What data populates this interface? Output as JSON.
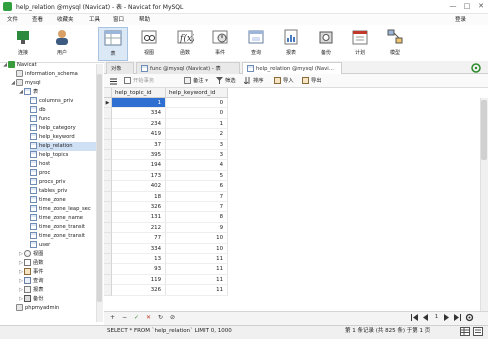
{
  "window": {
    "title": "help_relation @mysql (Navicat) - 表 - Navicat for MySQL",
    "controls": [
      "—",
      "□",
      "✕"
    ]
  },
  "menu": {
    "items": [
      "文件",
      "查看",
      "收藏夹",
      "工具",
      "窗口",
      "帮助"
    ],
    "login": "登录"
  },
  "toolbar": {
    "buttons": [
      {
        "label": "连接",
        "icon": "connection-icon"
      },
      {
        "label": "用户",
        "icon": "user-icon"
      },
      {
        "label": "表",
        "icon": "table-icon"
      },
      {
        "label": "视图",
        "icon": "view-icon"
      },
      {
        "label": "函数",
        "icon": "function-icon"
      },
      {
        "label": "事件",
        "icon": "event-icon"
      },
      {
        "label": "查询",
        "icon": "query-icon"
      },
      {
        "label": "报表",
        "icon": "report-icon"
      },
      {
        "label": "备份",
        "icon": "backup-icon"
      },
      {
        "label": "计划",
        "icon": "schedule-icon"
      },
      {
        "label": "模型",
        "icon": "model-icon"
      }
    ]
  },
  "sidebar": {
    "root": "Navicat",
    "db1": "information_schema",
    "db2": "mysql",
    "tables_group": "表",
    "tables": [
      "columns_priv",
      "db",
      "func",
      "help_category",
      "help_keyword",
      "help_relation",
      "help_topics",
      "host",
      "proc",
      "procs_priv",
      "tables_priv",
      "time_zone",
      "time_zone_leap_sec",
      "time_zone_name",
      "time_zone_transit",
      "time_zone_transit",
      "user"
    ],
    "groups": [
      "视图",
      "函数",
      "事件",
      "查询",
      "报表",
      "备份"
    ],
    "db3": "phpmyadmin"
  },
  "tabs": [
    "对象",
    "func @mysql (Navicat) - 表",
    "help_relation @mysql (Navi..."
  ],
  "subtoolbar": {
    "begin_tx": "开始事务",
    "note": "备注",
    "filter": "筛选",
    "sort": "排序",
    "import": "导入",
    "export": "导出"
  },
  "grid": {
    "columns": [
      "help_topic_id",
      "help_keyword_id"
    ],
    "rows": [
      [
        "1",
        "0"
      ],
      [
        "334",
        "0"
      ],
      [
        "234",
        "1"
      ],
      [
        "419",
        "2"
      ],
      [
        "37",
        "3"
      ],
      [
        "395",
        "3"
      ],
      [
        "194",
        "4"
      ],
      [
        "173",
        "5"
      ],
      [
        "402",
        "6"
      ],
      [
        "18",
        "7"
      ],
      [
        "326",
        "7"
      ],
      [
        "131",
        "8"
      ],
      [
        "212",
        "9"
      ],
      [
        "77",
        "10"
      ],
      [
        "334",
        "10"
      ],
      [
        "13",
        "11"
      ],
      [
        "93",
        "11"
      ],
      [
        "119",
        "11"
      ],
      [
        "326",
        "11"
      ]
    ]
  },
  "navbar": {
    "icons": [
      "+",
      "−",
      "✓",
      "✕",
      "↻",
      "⊘"
    ]
  },
  "status": {
    "sql": "SELECT * FROM `help_relation` LIMIT 0, 1000",
    "records": "第 1 条记录 (共 825 条) 于第 1 页"
  }
}
